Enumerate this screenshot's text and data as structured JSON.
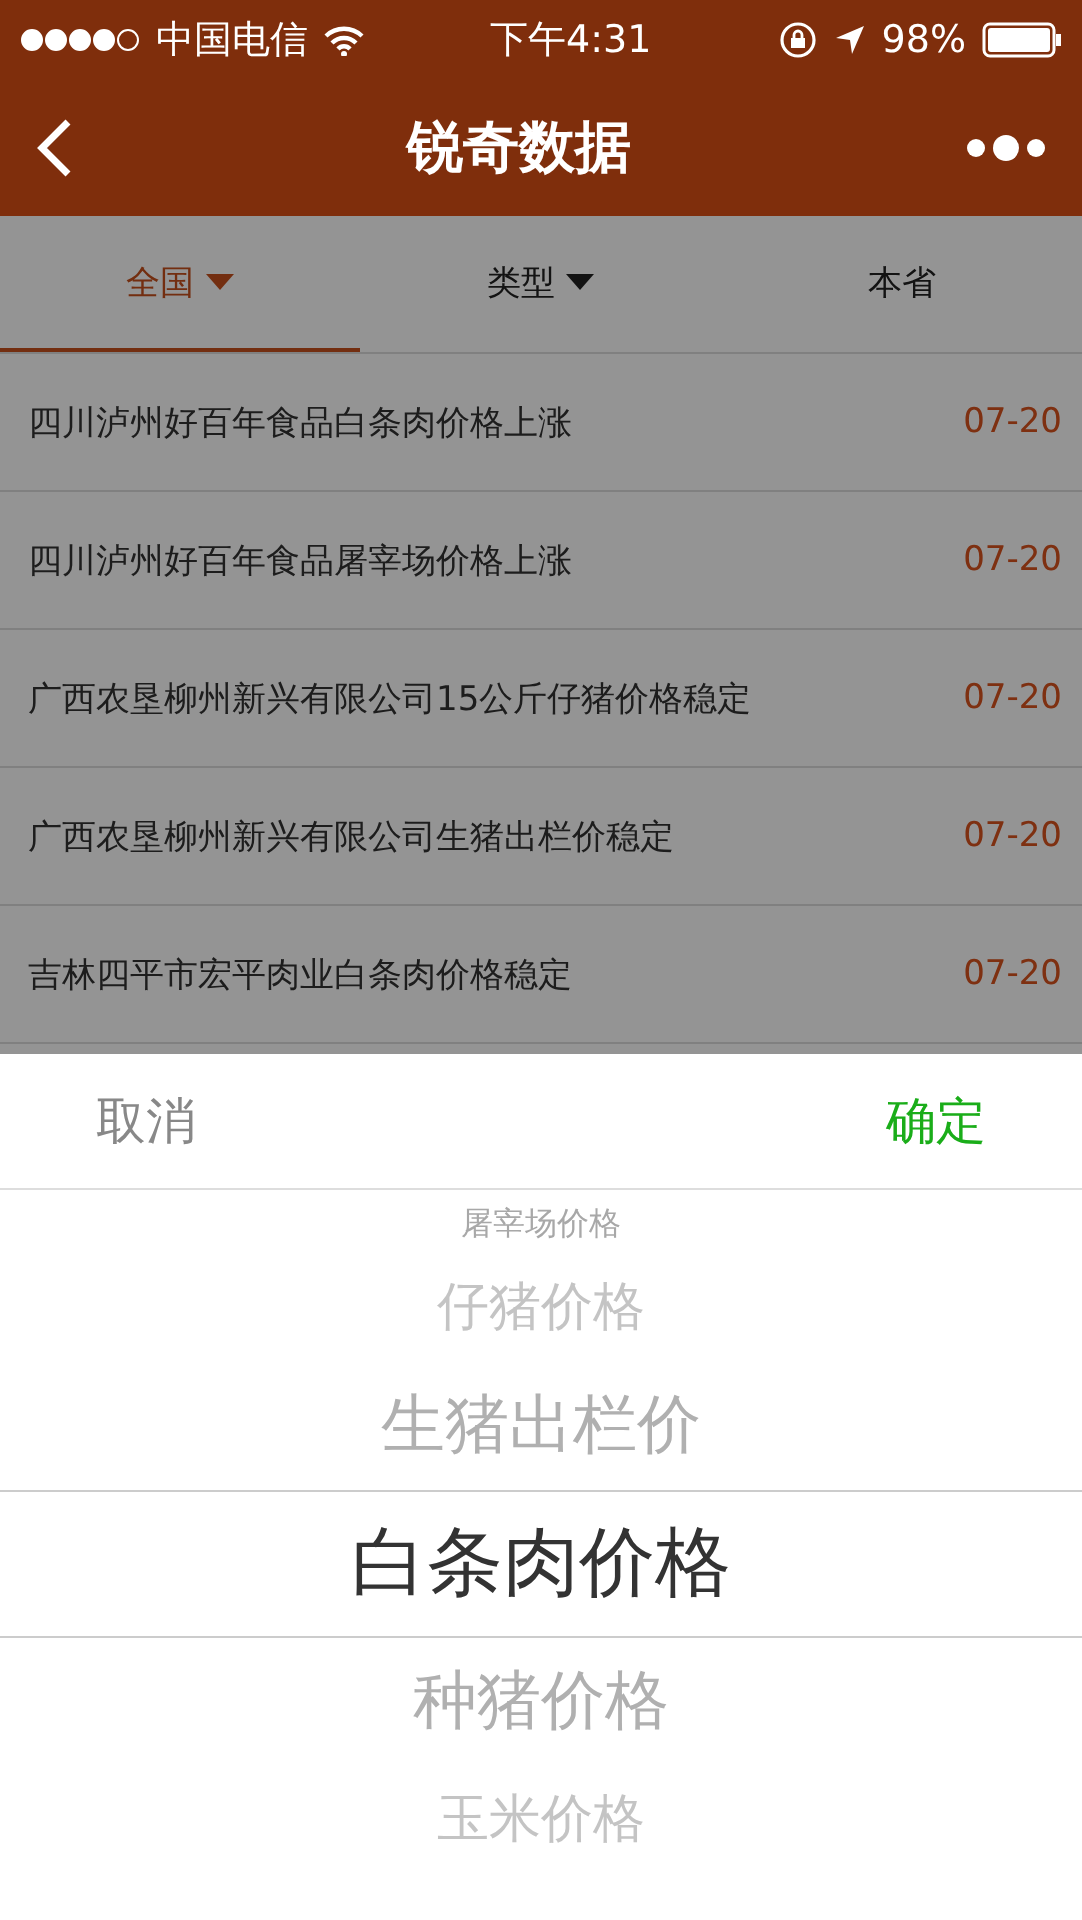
{
  "status_bar": {
    "carrier": "中国电信",
    "time": "下午4:31",
    "battery": "98%"
  },
  "nav": {
    "title": "锐奇数据"
  },
  "tabs": [
    {
      "label": "全国",
      "selected": true,
      "dropdown": true
    },
    {
      "label": "类型",
      "selected": false,
      "dropdown": true
    },
    {
      "label": "本省",
      "selected": false,
      "dropdown": false
    }
  ],
  "news": [
    {
      "title": "四川泸州好百年食品白条肉价格上涨",
      "date": "07-20"
    },
    {
      "title": "四川泸州好百年食品屠宰场价格上涨",
      "date": "07-20"
    },
    {
      "title": "广西农垦柳州新兴有限公司15公斤仔猪价格稳定",
      "date": "07-20"
    },
    {
      "title": "广西农垦柳州新兴有限公司生猪出栏价稳定",
      "date": "07-20"
    },
    {
      "title": "吉林四平市宏平肉业白条肉价格稳定",
      "date": "07-20"
    }
  ],
  "picker": {
    "cancel": "取消",
    "confirm": "确定",
    "options": [
      {
        "label": "屠宰场价格",
        "selected": false
      },
      {
        "label": "仔猪价格",
        "selected": false
      },
      {
        "label": "生猪出栏价",
        "selected": false
      },
      {
        "label": "白条肉价格",
        "selected": true
      },
      {
        "label": "种猪价格",
        "selected": false
      },
      {
        "label": "玉米价格",
        "selected": false
      }
    ]
  }
}
